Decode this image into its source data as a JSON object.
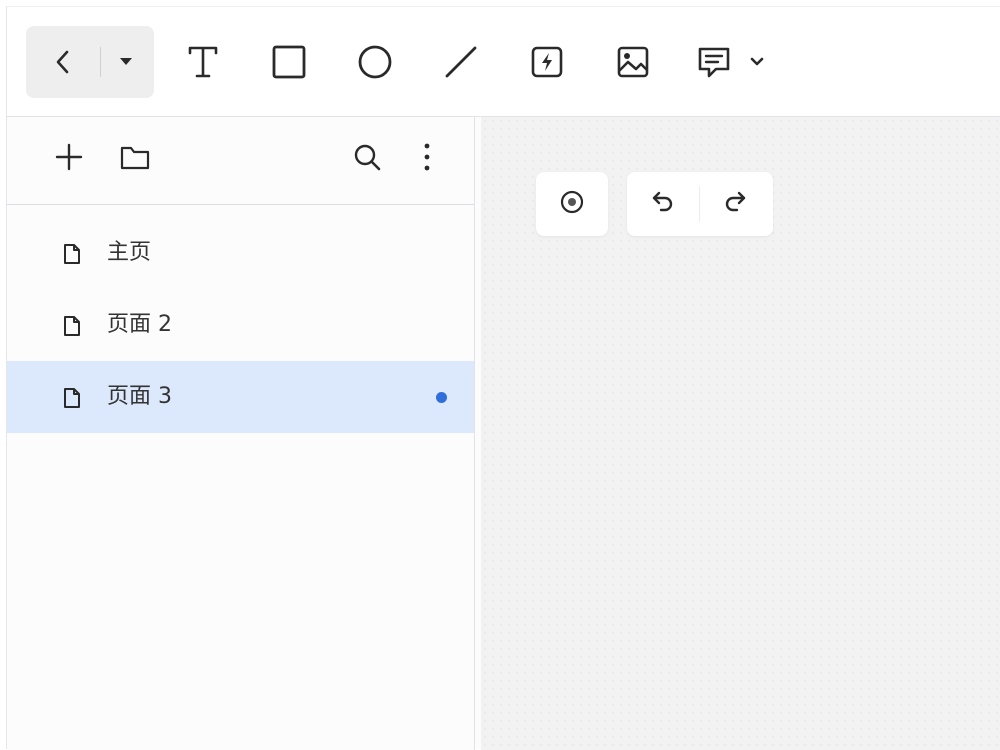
{
  "toolbar": {
    "tools": [
      {
        "name": "back",
        "icon": "chevron-left-icon"
      },
      {
        "name": "menu",
        "icon": "caret-down-icon"
      },
      {
        "name": "text",
        "icon": "text-icon"
      },
      {
        "name": "rectangle",
        "icon": "rectangle-icon"
      },
      {
        "name": "ellipse",
        "icon": "circle-icon"
      },
      {
        "name": "line",
        "icon": "line-icon"
      },
      {
        "name": "interaction",
        "icon": "lightning-box-icon"
      },
      {
        "name": "image",
        "icon": "image-icon"
      },
      {
        "name": "comment",
        "icon": "comment-icon"
      },
      {
        "name": "more",
        "icon": "chevron-down-icon"
      }
    ]
  },
  "sidebar": {
    "header_icons": [
      "plus-icon",
      "folder-icon",
      "search-icon",
      "more-vertical-icon"
    ],
    "pages": [
      {
        "label": "主页",
        "selected": false,
        "has_dot": false
      },
      {
        "label": "页面 2",
        "selected": false,
        "has_dot": false
      },
      {
        "label": "页面 3",
        "selected": true,
        "has_dot": true
      }
    ]
  },
  "canvas": {
    "controls": [
      "target-icon",
      "undo-icon",
      "redo-icon"
    ]
  },
  "colors": {
    "selected_bg": "#dce8fb",
    "dot": "#2f6fdb",
    "canvas_bg": "#f2f2f3"
  }
}
